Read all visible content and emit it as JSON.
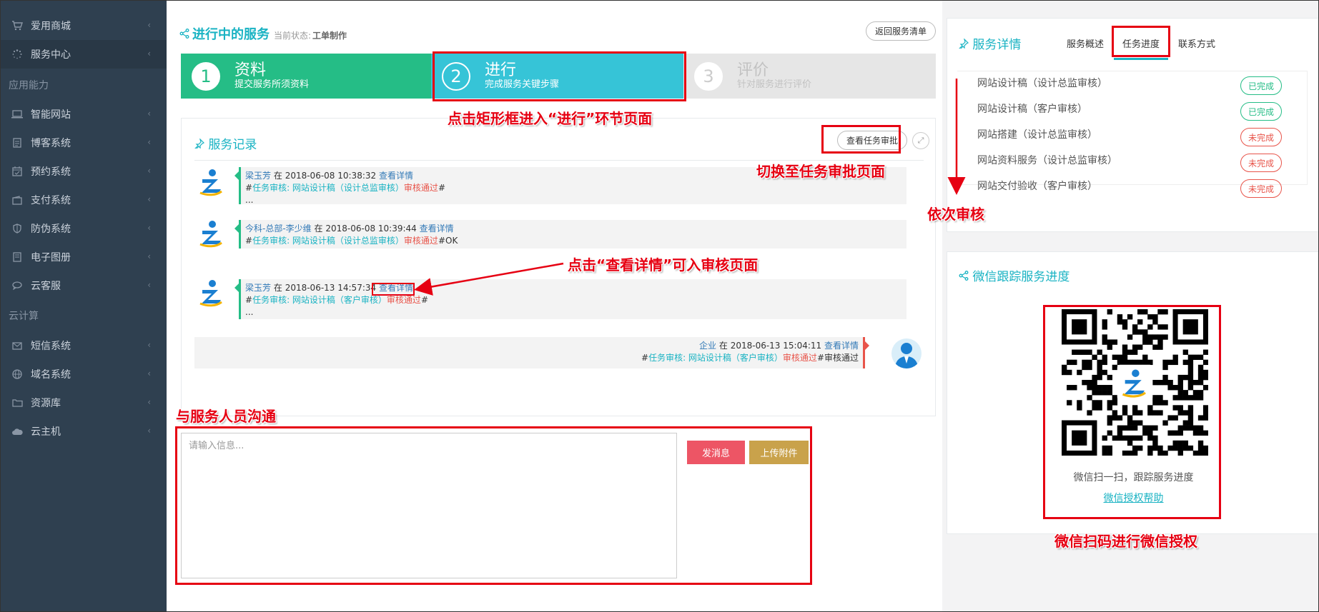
{
  "sidebar": {
    "items_top": [
      {
        "label": "爱用商城",
        "icon": "cart-icon",
        "active": false
      },
      {
        "label": "服务中心",
        "icon": "spinner-icon",
        "active": true
      }
    ],
    "section1": "应用能力",
    "items_app": [
      {
        "label": "智能网站",
        "icon": "laptop-icon"
      },
      {
        "label": "博客系统",
        "icon": "document-icon"
      },
      {
        "label": "预约系统",
        "icon": "calendar-icon"
      },
      {
        "label": "支付系统",
        "icon": "wallet-icon"
      },
      {
        "label": "防伪系统",
        "icon": "shield-icon"
      },
      {
        "label": "电子图册",
        "icon": "book-icon"
      },
      {
        "label": "云客服",
        "icon": "chat-icon"
      }
    ],
    "section2": "云计算",
    "items_cloud": [
      {
        "label": "短信系统",
        "icon": "mail-icon"
      },
      {
        "label": "域名系统",
        "icon": "globe-icon"
      },
      {
        "label": "资源库",
        "icon": "folder-icon"
      },
      {
        "label": "云主机",
        "icon": "cloud-icon"
      }
    ]
  },
  "header": {
    "title": "进行中的服务",
    "status_label": "当前状态:",
    "status_value": "工单制作",
    "back_button": "返回服务清单"
  },
  "steps": [
    {
      "num": "1",
      "name": "资料",
      "desc": "提交服务所须资料"
    },
    {
      "num": "2",
      "name": "进行",
      "desc": "完成服务关键步骤"
    },
    {
      "num": "3",
      "name": "评价",
      "desc": "针对服务进行评价"
    }
  ],
  "records": {
    "title": "服务记录",
    "audit_button": "查看任务审批",
    "messages": [
      {
        "user": "梁玉芳",
        "at": "在",
        "time": "2018-06-08 10:38:32",
        "detail": "查看详情",
        "prefix": "#",
        "task": "任务审核: 网站设计稿（设计总监审核）",
        "result": "审核通过",
        "suffix": "#",
        "extra": "..."
      },
      {
        "user": "今科-总部-李少维",
        "at": "在",
        "time": "2018-06-08 10:39:44",
        "detail": "查看详情",
        "prefix": "#",
        "task": "任务审核: 网站设计稿（设计总监审核）",
        "result": "审核通过",
        "suffix": "#OK",
        "extra": ""
      },
      {
        "user": "梁玉芳",
        "at": "在",
        "time": "2018-06-13 14:57:34",
        "detail": "查看详情",
        "prefix": "#",
        "task": "任务审核: 网站设计稿（客户审核）",
        "result": "审核通过",
        "suffix": "#",
        "extra": "..."
      }
    ],
    "reply": {
      "user": "企业",
      "at": "在",
      "time": "2018-06-13 15:04:11",
      "detail": "查看详情",
      "prefix": "#",
      "task": "任务审核: 网站设计稿（客户审核）",
      "result": "审核通过",
      "suffix": "#审核通过"
    }
  },
  "chat": {
    "placeholder": "请输入信息...",
    "send_button": "发消息",
    "upload_button": "上传附件"
  },
  "detail_panel": {
    "title": "服务详情",
    "tabs": [
      "服务概述",
      "任务进度",
      "联系方式"
    ],
    "active_tab": "任务进度",
    "tasks": [
      {
        "name": "网站设计稿（设计总监审核）",
        "status": "已完成",
        "done": true
      },
      {
        "name": "网站设计稿（客户审核）",
        "status": "已完成",
        "done": true
      },
      {
        "name": "网站搭建（设计总监审核）",
        "status": "未完成",
        "done": false
      },
      {
        "name": "网站资料服务（设计总监审核）",
        "status": "未完成",
        "done": false
      },
      {
        "name": "网站交付验收（客户审核）",
        "status": "未完成",
        "done": false
      }
    ]
  },
  "wechat_panel": {
    "title": "微信跟踪服务进度",
    "caption": "微信扫一扫，跟踪服务进度",
    "link": "微信授权帮助"
  },
  "annotations": {
    "step_click": "点击矩形框进入“进行”环节页面",
    "audit_switch": "切换至任务审批页面",
    "detail_click": "点击“查看详情”可入审核页面",
    "order": "依次审核",
    "chat": "与服务人员沟通",
    "wechat": "微信扫码进行微信授权"
  },
  "colors": {
    "accent": "#1ab3c3",
    "green": "#25bd86",
    "cyan": "#36c4d7",
    "red": "#e8544a",
    "sidebar": "#2f4050",
    "annotation": "#e60012"
  }
}
